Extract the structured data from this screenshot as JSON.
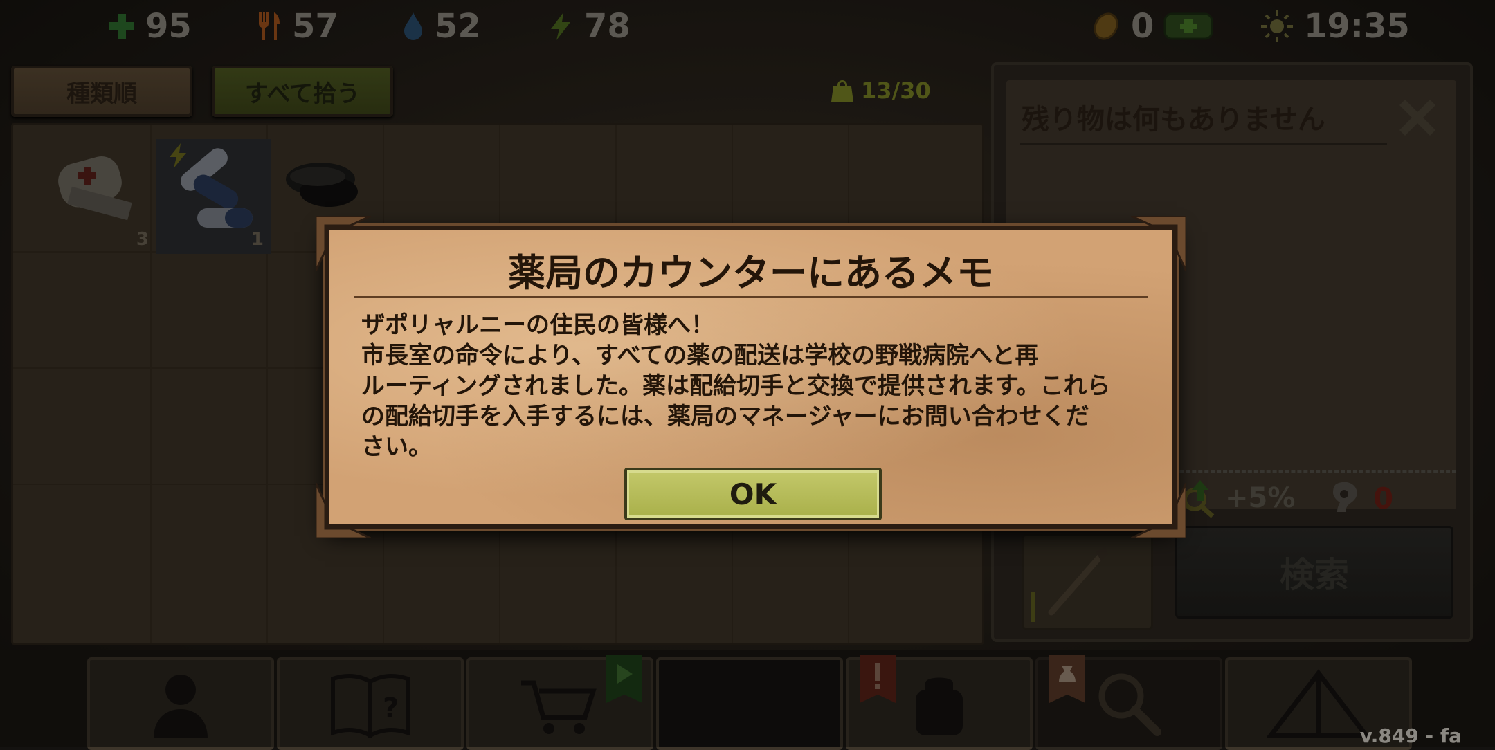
{
  "status": {
    "health": "95",
    "food": "57",
    "water": "52",
    "energy": "78",
    "coins": "0",
    "time": "19:35"
  },
  "toolbar": {
    "sort_label": "種類順",
    "pick_all_label": "すべて拾う",
    "bag_count": "13/30"
  },
  "inventory": {
    "items": [
      {
        "name": "bandage",
        "count": "3"
      },
      {
        "name": "pills",
        "count": "1"
      },
      {
        "name": "black-discs",
        "count": ""
      }
    ]
  },
  "loot": {
    "title": "残り物は何もありません",
    "bonus": "+5%",
    "noise": "0",
    "search_label": "検索"
  },
  "dialog": {
    "title": "薬局のカウンターにあるメモ",
    "lines": [
      "ザポリャルニーの住民の皆様へ！",
      "市長室の命令により、すべての薬の配送は学校の野戦病院へと再",
      "ルーティングされました。薬は配給切手と交換で提供されます。これら",
      "の配給切手を入手するには、薬局のマネージャーにお問い合わせくだ",
      "さい。"
    ],
    "ok_label": "OK"
  },
  "version": "v.849 - fa",
  "colors": {
    "dialog_bg": "#d2a274",
    "ok_bg": "#b8bd5b",
    "health": "#2f6e2f",
    "food": "#a4531c",
    "water": "#2a4d6e",
    "energy": "#4d6b1f"
  }
}
